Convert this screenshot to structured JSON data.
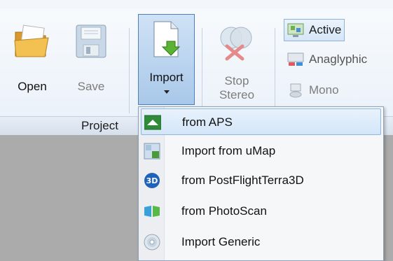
{
  "ribbon": {
    "buttons": {
      "open": "Open",
      "save": "Save",
      "import": "Import",
      "stop_stereo_line1": "Stop",
      "stop_stereo_line2": "Stereo"
    },
    "stereo_modes": {
      "active": "Active",
      "anaglyphic": "Anaglyphic",
      "mono": "Mono"
    },
    "groups": {
      "project": "Project"
    }
  },
  "import_menu": {
    "items": [
      {
        "label": "from APS",
        "icon": "aps-icon"
      },
      {
        "label": "Import from uMap",
        "icon": "umap-icon"
      },
      {
        "label": "from PostFlightTerra3D",
        "icon": "3d-icon"
      },
      {
        "label": "from PhotoScan",
        "icon": "photoscan-icon"
      },
      {
        "label": "Import Generic",
        "icon": "disc-icon"
      }
    ]
  },
  "colors": {
    "accent": "#2f8a3a",
    "highlight": "#d3e6f9"
  }
}
